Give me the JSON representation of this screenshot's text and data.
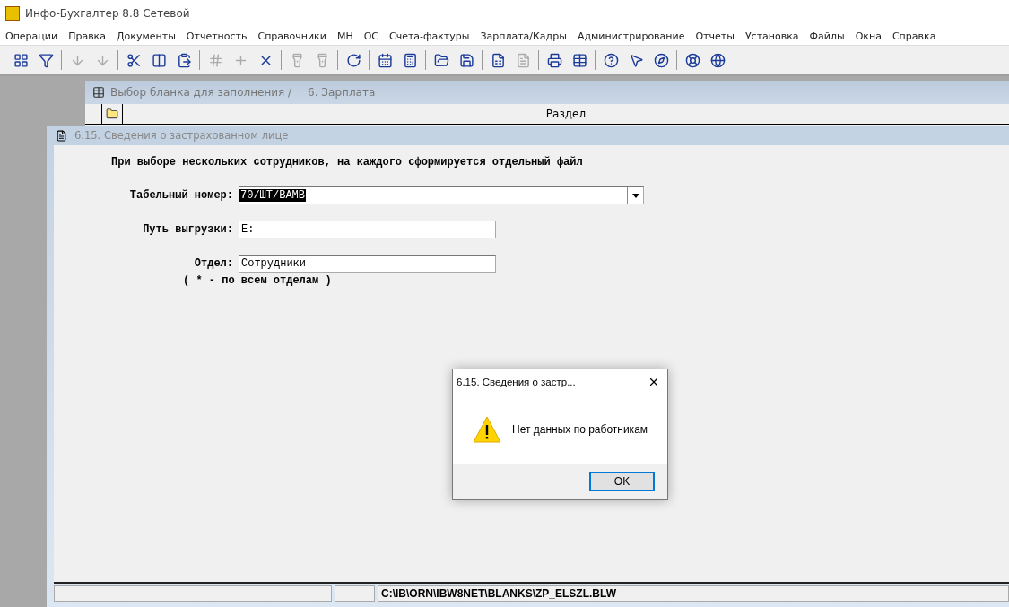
{
  "window": {
    "title": "Инфо-Бухгалтер 8.8 Сетевой"
  },
  "menu": [
    "Операции",
    "Правка",
    "Документы",
    "Отчетность",
    "Справочники",
    "МН",
    "ОС",
    "Счета-фактуры",
    "Зарплата/Кадры",
    "Администрирование",
    "Отчеты",
    "Установка",
    "Файлы",
    "Окна",
    "Справка"
  ],
  "toolbar": [
    [
      {
        "disabled": false
      },
      {
        "disabled": false
      }
    ],
    [
      {
        "disabled": true
      },
      {
        "disabled": true
      }
    ],
    [
      {
        "disabled": false
      },
      {
        "disabled": false
      },
      {
        "disabled": false
      }
    ],
    [
      {
        "disabled": true
      },
      {
        "disabled": true
      },
      {
        "disabled": false
      }
    ],
    [
      {
        "disabled": true
      },
      {
        "disabled": true
      }
    ],
    [
      {
        "disabled": false
      }
    ],
    [
      {
        "disabled": false
      },
      {
        "disabled": false
      }
    ],
    [
      {
        "disabled": false
      },
      {
        "disabled": false
      }
    ],
    [
      {
        "disabled": false
      },
      {
        "disabled": true
      }
    ],
    [
      {
        "disabled": false
      },
      {
        "disabled": false
      }
    ],
    [
      {
        "disabled": false
      },
      {
        "disabled": false
      },
      {
        "disabled": false
      }
    ],
    [
      {
        "disabled": false
      },
      {
        "disabled": false
      }
    ]
  ],
  "back_window": {
    "title": "Выбор бланка для заполнения /",
    "subtitle": "6. Зарплата",
    "column": "Раздел"
  },
  "form_window": {
    "title": "6.15.  Сведения о застрахованном лице",
    "note": "При выборе нескольких сотрудников, на каждого сформируется отдельный файл",
    "fields": [
      {
        "label": "Табельный номер:",
        "value": "70/ШТ/ВАМВ",
        "kind": "combo"
      },
      {
        "label": "Путь выгрузки:",
        "value": "E:",
        "kind": "text"
      },
      {
        "label": "Отдел:",
        "value": "Сотрудники",
        "kind": "text"
      }
    ],
    "hint": "( * - по всем отделам )"
  },
  "status_bar": {
    "path": "C:\\IB\\ORN\\IBW8NET\\BLANKS\\ZP_ELSZL.BLW"
  },
  "dialog": {
    "title": "6.15.   Сведения о застр...",
    "message": "Нет данных по работникам",
    "button": "OK"
  }
}
